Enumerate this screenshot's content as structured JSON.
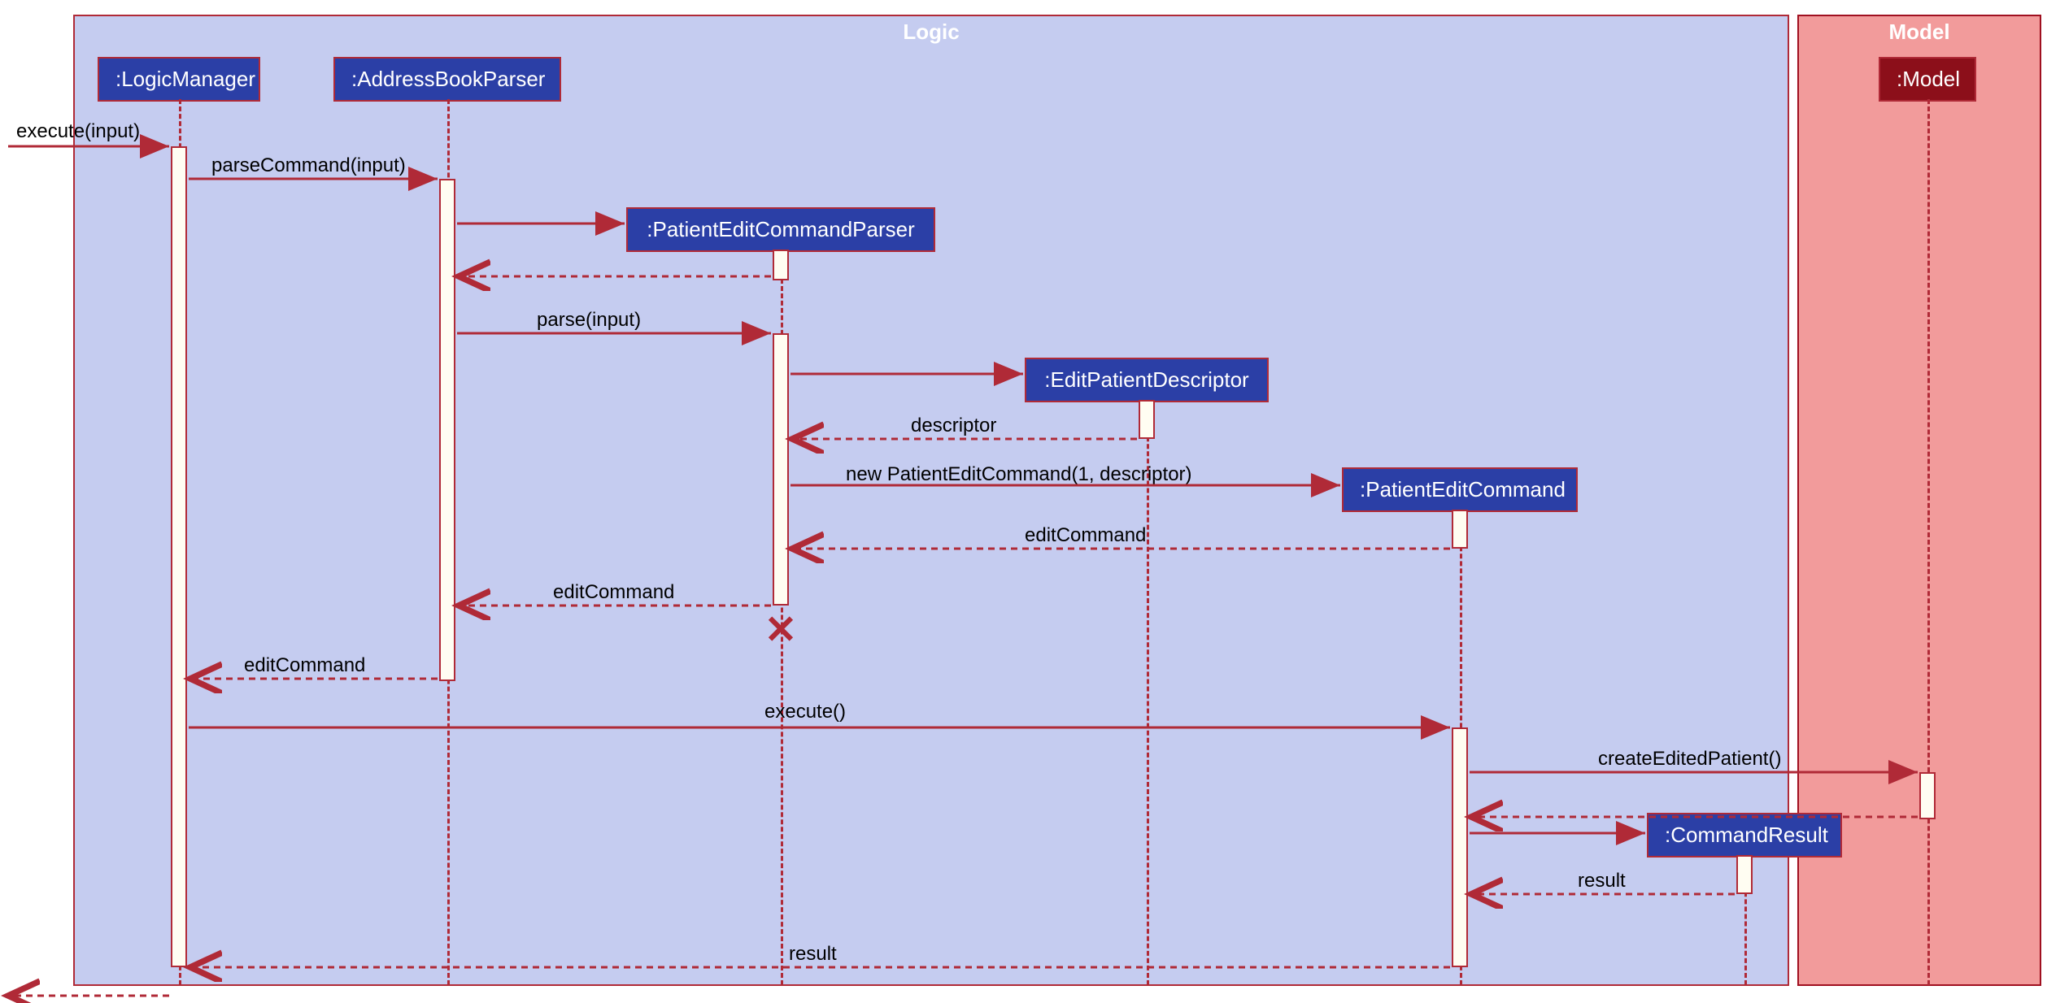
{
  "frames": {
    "logic": "Logic",
    "model": "Model"
  },
  "participants": {
    "logicManager": ":LogicManager",
    "addressBookParser": ":AddressBookParser",
    "patientEditCommandParser": ":PatientEditCommandParser",
    "editPatientDescriptor": ":EditPatientDescriptor",
    "patientEditCommand": ":PatientEditCommand",
    "commandResult": ":CommandResult",
    "model": ":Model"
  },
  "messages": {
    "executeInput": "execute(input)",
    "parseCommand": "parseCommand(input)",
    "parseInput": "parse(input)",
    "descriptor": "descriptor",
    "newPatientEditCommand": "new PatientEditCommand(1, descriptor)",
    "editCommand1": "editCommand",
    "editCommand2": "editCommand",
    "editCommand3": "editCommand",
    "execute": "execute()",
    "createEditedPatient": "createEditedPatient()",
    "result1": "result",
    "result2": "result"
  },
  "colors": {
    "logicBg": "#C5CCF0",
    "modelBg": "#F29B9B",
    "participantBg": "#2B3FA6",
    "modelParticipantBg": "#8C0F1A",
    "border": "#B02A37",
    "activationBg": "#FFFDF2"
  }
}
